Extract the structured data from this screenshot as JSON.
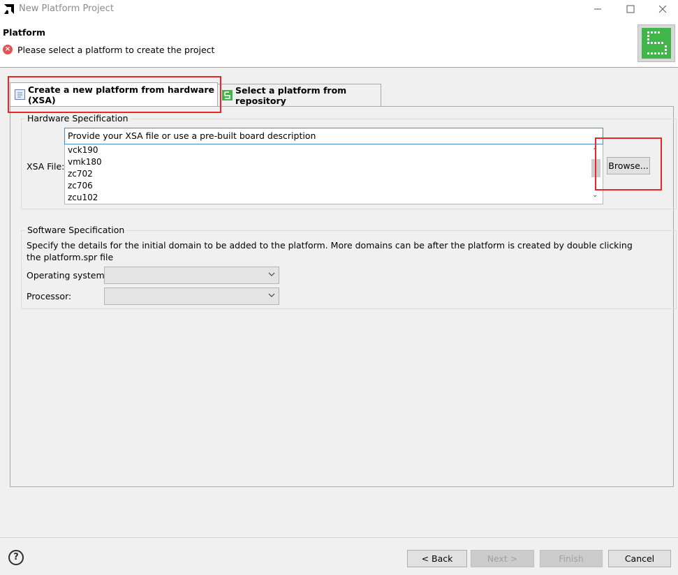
{
  "window": {
    "title": "New Platform Project",
    "controls": {
      "minimize": "minimize-icon",
      "maximize": "maximize-icon",
      "close": "close-icon"
    }
  },
  "header": {
    "title": "Platform",
    "message": "Please select a platform to create the project",
    "message_icon": "error-icon"
  },
  "tabs": [
    {
      "label": "Create a new platform from hardware (XSA)",
      "icon": "hardware-page-icon",
      "selected": true
    },
    {
      "label": "Select a platform from repository",
      "icon": "platform-repository-icon",
      "selected": false
    }
  ],
  "hardware_spec": {
    "group_label": "Hardware Specification",
    "xsa_label": "XSA File:",
    "xsa_placeholder": "Provide your XSA file or use a pre-built board description",
    "options": [
      "vck190",
      "vmk180",
      "zc702",
      "zc706",
      "zcu102"
    ],
    "browse_label": "Browse..."
  },
  "software_spec": {
    "group_label": "Software Specification",
    "description": "Specify the details for the initial domain to be added to the platform. More domains can be after the platform is created by double clicking the platform.spr file",
    "os_label": "Operating system:",
    "os_value": "",
    "processor_label": "Processor:",
    "processor_value": ""
  },
  "footer": {
    "back": "< Back",
    "next": "Next >",
    "finish": "Finish",
    "cancel": "Cancel",
    "help_icon": "help-icon"
  },
  "colors": {
    "highlight": "#e8262e",
    "accent_green": "#3fb54a",
    "error": "#e05555"
  }
}
